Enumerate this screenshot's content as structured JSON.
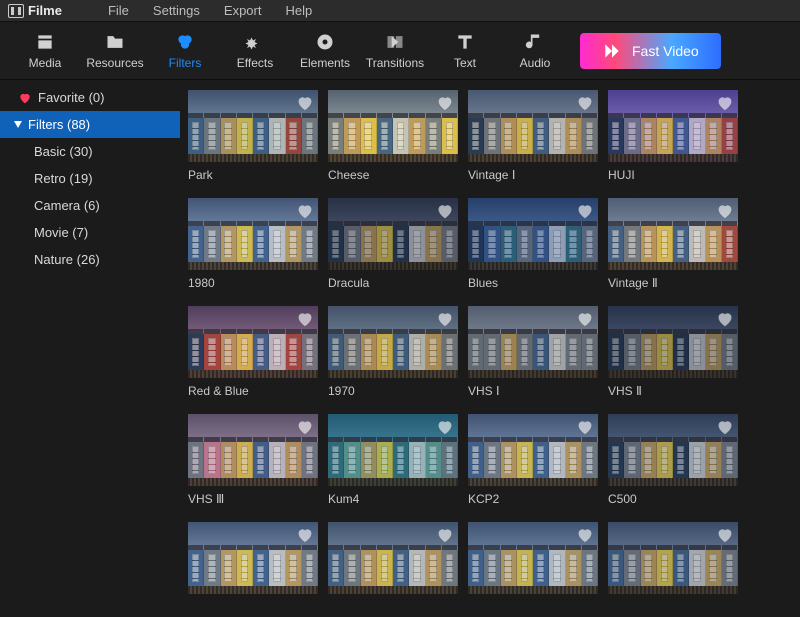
{
  "app": {
    "name": "Filme"
  },
  "menu": {
    "file": "File",
    "settings": "Settings",
    "export": "Export",
    "help": "Help"
  },
  "toolbar": {
    "media": "Media",
    "resources": "Resources",
    "filters": "Filters",
    "effects": "Effects",
    "elements": "Elements",
    "transitions": "Transitions",
    "text": "Text",
    "audio": "Audio",
    "fast_video": "Fast Video"
  },
  "sidebar": {
    "favorite": "Favorite (0)",
    "filters": "Filters (88)",
    "subs": {
      "basic": "Basic (30)",
      "retro": "Retro (19)",
      "camera": "Camera (6)",
      "movie": "Movie (7)",
      "nature": "Nature (26)"
    }
  },
  "filters": [
    {
      "name": "Park"
    },
    {
      "name": "Cheese"
    },
    {
      "name": "Vintage Ⅰ"
    },
    {
      "name": "HUJI"
    },
    {
      "name": "1980"
    },
    {
      "name": "Dracula"
    },
    {
      "name": "Blues"
    },
    {
      "name": "Vintage Ⅱ"
    },
    {
      "name": "Red & Blue"
    },
    {
      "name": "1970"
    },
    {
      "name": "VHS Ⅰ"
    },
    {
      "name": "VHS Ⅱ"
    },
    {
      "name": "VHS Ⅲ"
    },
    {
      "name": "Kum4"
    },
    {
      "name": "KCP2"
    },
    {
      "name": "C500"
    },
    {
      "name": ""
    },
    {
      "name": ""
    },
    {
      "name": ""
    },
    {
      "name": ""
    }
  ]
}
